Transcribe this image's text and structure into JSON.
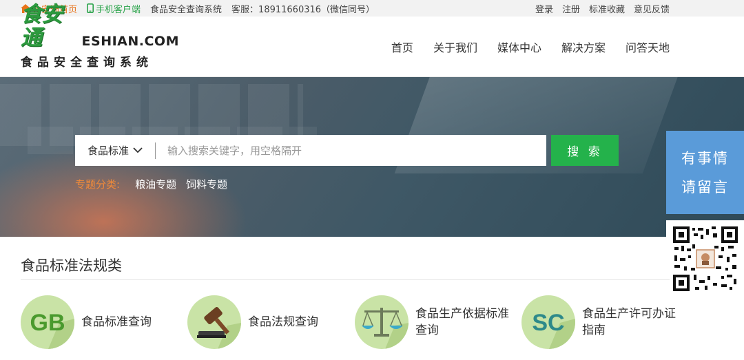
{
  "topbar": {
    "home": "食安通首页",
    "mobile": "手机客户端",
    "system": "食品安全查询系统",
    "service": "客服：18911660316（微信同号）",
    "login": "登录",
    "register": "注册",
    "favorites": "标准收藏",
    "feedback": "意见反馈"
  },
  "logo": {
    "cn": "食安通",
    "en": "ESHIAN.COM",
    "sub": "食品安全查询系统"
  },
  "nav": [
    {
      "label": "首页"
    },
    {
      "label": "关于我们"
    },
    {
      "label": "媒体中心"
    },
    {
      "label": "解决方案"
    },
    {
      "label": "问答天地"
    }
  ],
  "search": {
    "category": "食品标准",
    "placeholder": "输入搜索关键字，用空格隔开",
    "button": "搜 索"
  },
  "topics": {
    "label": "专题分类:",
    "items": [
      "粮油专题",
      "饲料专题"
    ]
  },
  "side": {
    "line1": "有事情",
    "line2": "请留言"
  },
  "section": {
    "title": "食品标准法规类",
    "items": [
      {
        "label": "食品标准查询",
        "icon": "gb-icon",
        "icon_text": "GB"
      },
      {
        "label": "食品法规查询",
        "icon": "gavel-icon"
      },
      {
        "label": "食品生产依据标准查询",
        "icon": "scales-icon"
      },
      {
        "label": "食品生产许可办证指南",
        "icon": "sc-icon",
        "icon_text": "SC"
      }
    ]
  },
  "colors": {
    "brand_green": "#2c9a3e",
    "search_button": "#24b24b",
    "topic_label": "#ef8a3a",
    "side_blue": "#5a9bd9",
    "icon_circle": "#c9e3a6"
  }
}
